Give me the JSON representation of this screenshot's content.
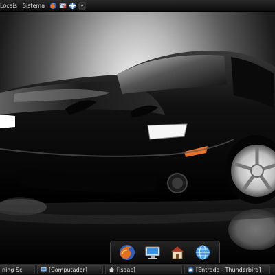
{
  "top_panel": {
    "menus": [
      {
        "label": "Locais"
      },
      {
        "label": "Sistema"
      }
    ],
    "launchers": [
      {
        "icon": "firefox-icon"
      },
      {
        "icon": "mail-icon"
      },
      {
        "icon": "help-icon"
      }
    ],
    "overflow_icon": "panel-arrow-icon"
  },
  "desktop": {
    "wallpaper": "black sports car",
    "colors": {
      "car_body": "#0d0d0d",
      "headlight": "#ffffff",
      "indicator": "#e8722a"
    }
  },
  "dock": {
    "items": [
      {
        "icon": "firefox-icon"
      },
      {
        "icon": "computer-monitor-icon"
      },
      {
        "icon": "home-folder-icon"
      },
      {
        "icon": "network-globe-icon"
      }
    ]
  },
  "bottom_panel": {
    "tasks": [
      {
        "label": "ning Sc",
        "icon": ""
      },
      {
        "label": "[Computador]",
        "icon": "computer-icon"
      },
      {
        "label": "[isaac]",
        "icon": "home-folder-icon"
      },
      {
        "label": "[Entrada - Thunderbird]",
        "icon": "thunderbird-icon"
      }
    ]
  }
}
